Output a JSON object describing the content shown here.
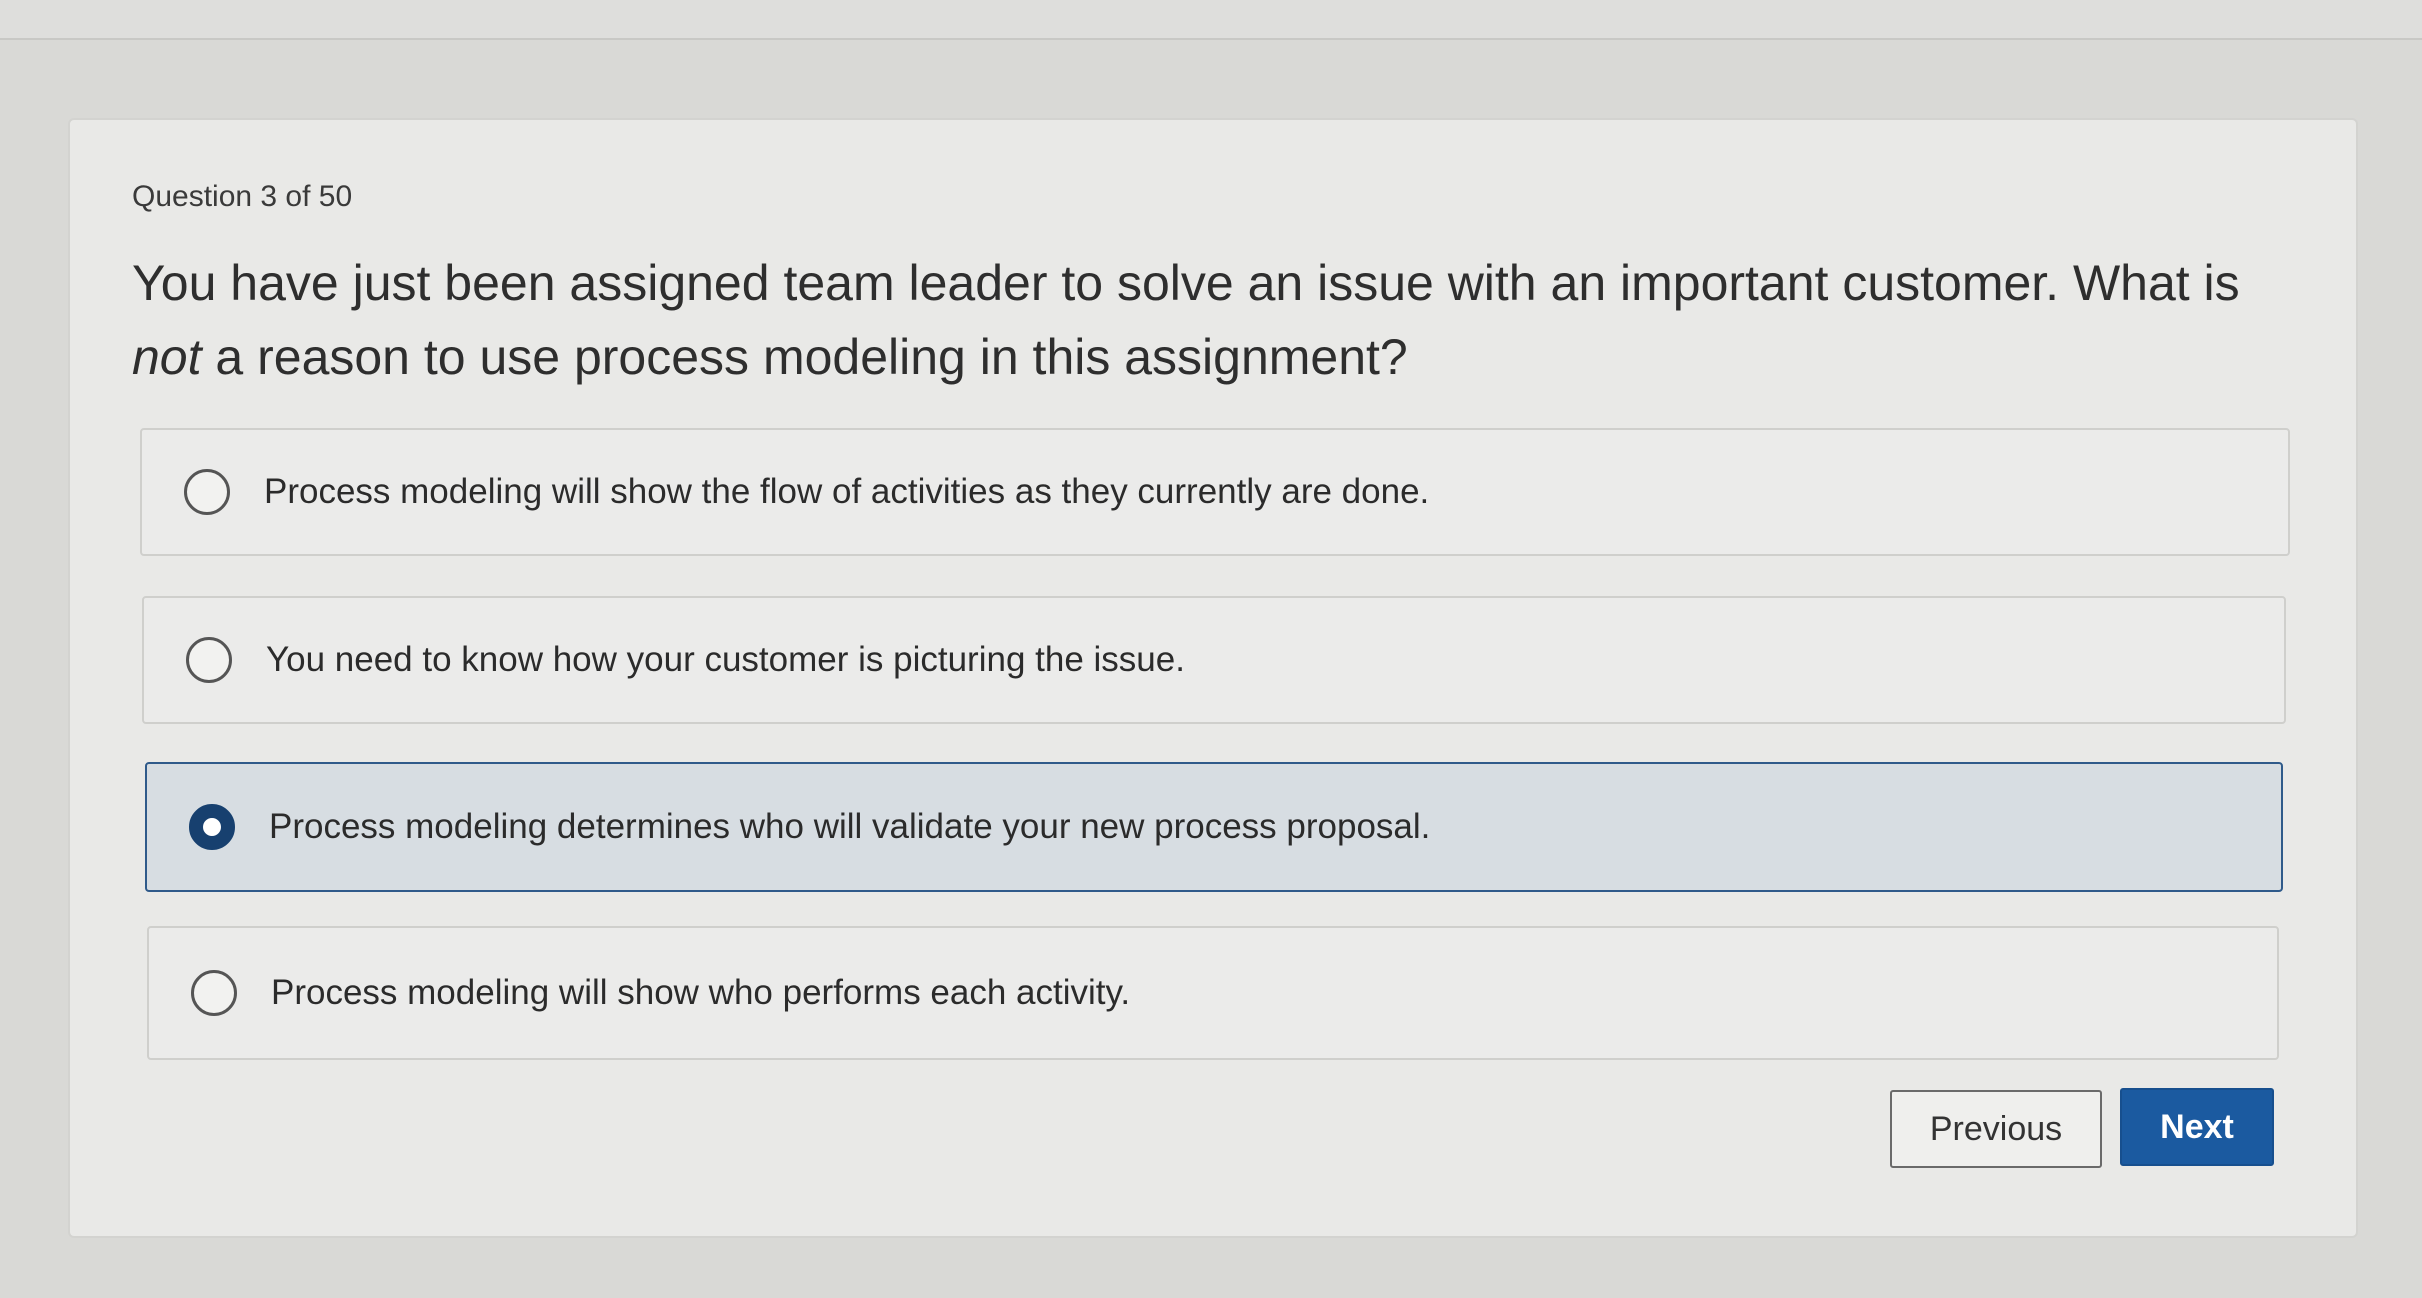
{
  "quiz": {
    "counter": "Question 3 of 50",
    "question_part1": "You have just been assigned team leader to solve an issue with an important customer. What is ",
    "question_emphasis": "not",
    "question_part2": " a reason to use process modeling in this assignment?",
    "options": [
      {
        "label": "Process modeling will show the flow of activities as they currently are done.",
        "selected": false
      },
      {
        "label": "You need to know how your customer is picturing the issue.",
        "selected": false
      },
      {
        "label": "Process modeling determines who will validate your new process proposal.",
        "selected": true
      },
      {
        "label": "Process modeling will show who performs each activity.",
        "selected": false
      }
    ]
  },
  "nav": {
    "previous_label": "Previous",
    "next_label": "Next"
  },
  "colors": {
    "accent": "#1b5aa0",
    "selected_background": "#d7dde2",
    "selected_border": "#2f5a8a"
  }
}
